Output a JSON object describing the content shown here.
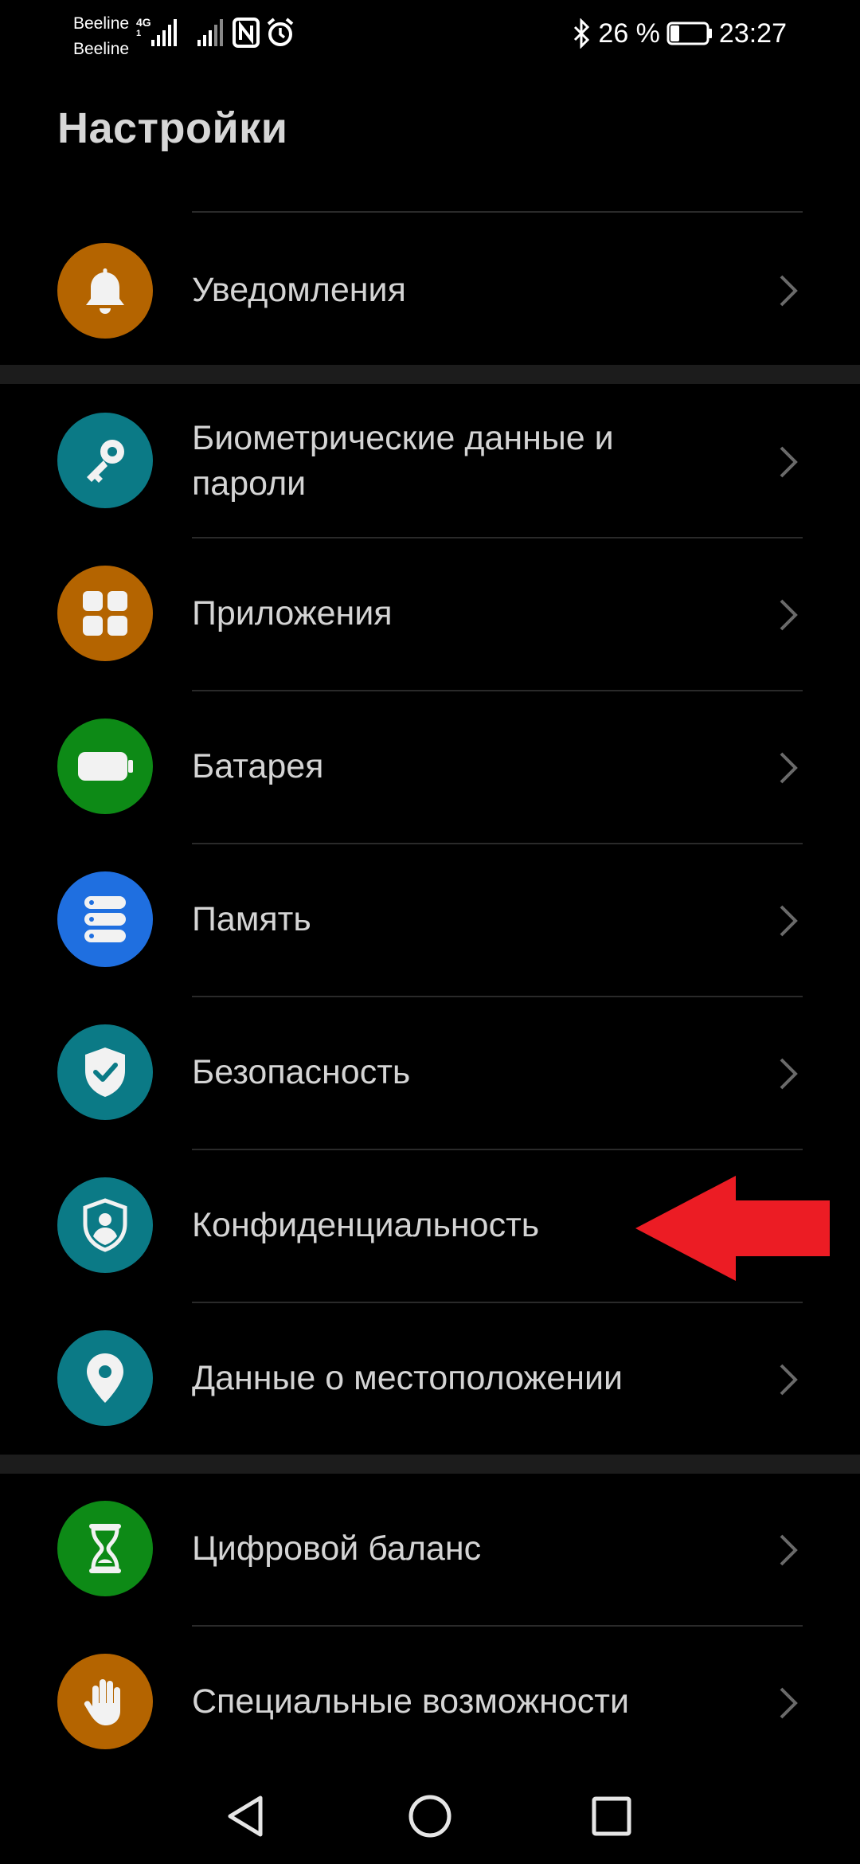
{
  "status_bar": {
    "carrier_1": "Beeline",
    "carrier_2": "Beeline",
    "network_type": "4G",
    "sim_slot": "1",
    "battery_percent": "26 %",
    "battery_level": 0.26,
    "time": "23:27",
    "icons": [
      "signal-icon",
      "nfc-icon",
      "alarm-icon",
      "bluetooth-icon",
      "battery-icon"
    ]
  },
  "header": {
    "title": "Настройки"
  },
  "settings": {
    "items": [
      {
        "label": "Уведомления",
        "icon": "bell-icon",
        "color": "#b46400"
      },
      {
        "label": "Биометрические данные и пароли",
        "icon": "key-icon",
        "color": "#0b7a86"
      },
      {
        "label": "Приложения",
        "icon": "apps-grid-icon",
        "color": "#b46400"
      },
      {
        "label": "Батарея",
        "icon": "battery-icon",
        "color": "#0d8a16"
      },
      {
        "label": "Память",
        "icon": "storage-icon",
        "color": "#1f6fe0"
      },
      {
        "label": "Безопасность",
        "icon": "shield-check-icon",
        "color": "#0b7a86"
      },
      {
        "label": "Конфиденциальность",
        "icon": "privacy-shield-icon",
        "color": "#0b7a86"
      },
      {
        "label": "Данные о местоположении",
        "icon": "location-pin-icon",
        "color": "#0b7a86"
      },
      {
        "label": "Цифровой баланс",
        "icon": "hourglass-icon",
        "color": "#0d8a16"
      },
      {
        "label": "Специальные возможности",
        "icon": "hand-icon",
        "color": "#b46400"
      }
    ]
  },
  "annotation": {
    "icon": "red-arrow-icon",
    "color": "#ec1c24"
  },
  "nav_bar": {
    "buttons": [
      "back-icon",
      "home-icon",
      "recents-icon"
    ]
  }
}
